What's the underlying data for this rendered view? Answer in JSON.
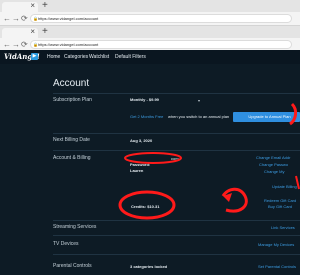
{
  "browser": {
    "url": "https://www.vidangel.com/account",
    "tab_close": "×",
    "new_tab": "+",
    "nav_icons": [
      "←",
      "→",
      "⟳"
    ]
  },
  "app": {
    "brand": "VidAngel",
    "logo_mark": "▶",
    "nav": [
      "Home",
      "Categories",
      "Watchlist",
      "Default Filters"
    ]
  },
  "account": {
    "title": "Account",
    "subscription": {
      "label": "Subscription Plan",
      "plan_value": "Monthly - $9.99",
      "promo_link": "Get 2 Months Free",
      "promo_suffix": "when you switch to an annual plan",
      "upgrade_button": "Upgrade to Annual Plan"
    },
    "billing_date": {
      "label": "Next Billing Date",
      "value": "Aug 3, 2020"
    },
    "account_billing": {
      "label": "Account & Billing",
      "email_suffix": "com",
      "password_label": "Password:",
      "name_value": "Lauren",
      "links": [
        "Change Email Addr",
        "Change Passwo",
        "Change My"
      ],
      "update_billing": "Update Billing",
      "credits": "Credits: $10.31",
      "redeem": "Redeem Gift Card",
      "buy_gift": "Buy Gift Card"
    },
    "streaming": {
      "label": "Streaming Services",
      "link": "Link Services"
    },
    "tv": {
      "label": "TV Devices",
      "link": "Manage My Devices"
    },
    "parental": {
      "label": "Parental Controls",
      "value": "3 categories locked",
      "link": "Set Parental Controls"
    }
  },
  "colors": {
    "background": "#0d1b25",
    "accent": "#2f8fe0",
    "annotation": "#ff1a1a"
  }
}
